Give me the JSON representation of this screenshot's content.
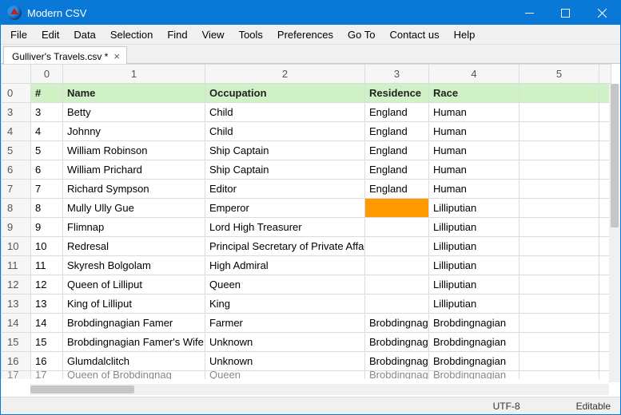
{
  "window": {
    "title": "Modern CSV"
  },
  "menu": [
    "File",
    "Edit",
    "Data",
    "Selection",
    "Find",
    "View",
    "Tools",
    "Preferences",
    "Go To",
    "Contact us",
    "Help"
  ],
  "tab": {
    "label": "Gulliver's Travels.csv *"
  },
  "colHeaders": [
    "0",
    "1",
    "2",
    "3",
    "4",
    "5"
  ],
  "header": {
    "rh": "0",
    "cells": [
      "#",
      "Name",
      "Occupation",
      "Residence",
      "Race",
      ""
    ]
  },
  "rows": [
    {
      "rh": "3",
      "c": [
        "3",
        "Betty",
        "Child",
        "England",
        "Human",
        ""
      ]
    },
    {
      "rh": "4",
      "c": [
        "4",
        "Johnny",
        "Child",
        "England",
        "Human",
        ""
      ]
    },
    {
      "rh": "5",
      "c": [
        "5",
        "William Robinson",
        "Ship Captain",
        "England",
        "Human",
        ""
      ]
    },
    {
      "rh": "6",
      "c": [
        "6",
        "William Prichard",
        "Ship Captain",
        "England",
        "Human",
        ""
      ]
    },
    {
      "rh": "7",
      "c": [
        "7",
        "Richard Sympson",
        "Editor",
        "England",
        "Human",
        ""
      ]
    },
    {
      "rh": "8",
      "c": [
        "8",
        "Mully Ully Gue",
        "Emperor",
        "",
        "Lilliputian",
        ""
      ],
      "hlCol": 3
    },
    {
      "rh": "9",
      "c": [
        "9",
        "Flimnap",
        "Lord High Treasurer",
        "",
        "Lilliputian",
        ""
      ]
    },
    {
      "rh": "10",
      "c": [
        "10",
        "Redresal",
        "Principal Secretary of Private Affairs",
        "",
        "Lilliputian",
        ""
      ]
    },
    {
      "rh": "11",
      "c": [
        "11",
        "Skyresh Bolgolam",
        "High Admiral",
        "",
        "Lilliputian",
        ""
      ]
    },
    {
      "rh": "12",
      "c": [
        "12",
        "Queen of Lilliput",
        "Queen",
        "",
        "Lilliputian",
        ""
      ]
    },
    {
      "rh": "13",
      "c": [
        "13",
        "King of Lilliput",
        "King",
        "",
        "Lilliputian",
        ""
      ]
    },
    {
      "rh": "14",
      "c": [
        "14",
        "Brobdingnagian Famer",
        "Farmer",
        "Brobdingnag",
        "Brobdingnagian",
        ""
      ]
    },
    {
      "rh": "15",
      "c": [
        "15",
        "Brobdingnagian Famer's Wife",
        "Unknown",
        "Brobdingnag",
        "Brobdingnagian",
        ""
      ]
    },
    {
      "rh": "16",
      "c": [
        "16",
        "Glumdalclitch",
        "Unknown",
        "Brobdingnag",
        "Brobdingnagian",
        ""
      ]
    }
  ],
  "partialRow": {
    "rh": "17",
    "c": [
      "17",
      "Queen of Brobdingnag",
      "Queen",
      "Brobdingnag",
      "Brobdingnagian",
      ""
    ]
  },
  "status": {
    "encoding": "UTF-8",
    "mode": "Editable"
  }
}
